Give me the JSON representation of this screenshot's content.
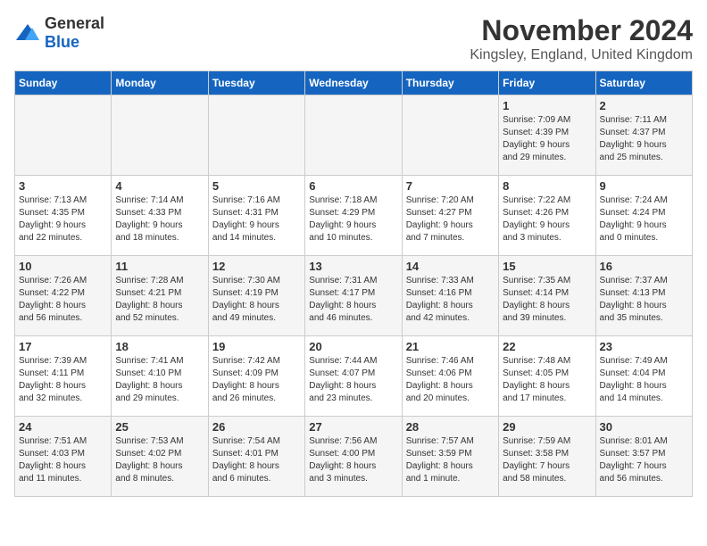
{
  "header": {
    "logo_general": "General",
    "logo_blue": "Blue",
    "month_title": "November 2024",
    "location": "Kingsley, England, United Kingdom"
  },
  "weekdays": [
    "Sunday",
    "Monday",
    "Tuesday",
    "Wednesday",
    "Thursday",
    "Friday",
    "Saturday"
  ],
  "weeks": [
    [
      {
        "day": "",
        "info": ""
      },
      {
        "day": "",
        "info": ""
      },
      {
        "day": "",
        "info": ""
      },
      {
        "day": "",
        "info": ""
      },
      {
        "day": "",
        "info": ""
      },
      {
        "day": "1",
        "info": "Sunrise: 7:09 AM\nSunset: 4:39 PM\nDaylight: 9 hours\nand 29 minutes."
      },
      {
        "day": "2",
        "info": "Sunrise: 7:11 AM\nSunset: 4:37 PM\nDaylight: 9 hours\nand 25 minutes."
      }
    ],
    [
      {
        "day": "3",
        "info": "Sunrise: 7:13 AM\nSunset: 4:35 PM\nDaylight: 9 hours\nand 22 minutes."
      },
      {
        "day": "4",
        "info": "Sunrise: 7:14 AM\nSunset: 4:33 PM\nDaylight: 9 hours\nand 18 minutes."
      },
      {
        "day": "5",
        "info": "Sunrise: 7:16 AM\nSunset: 4:31 PM\nDaylight: 9 hours\nand 14 minutes."
      },
      {
        "day": "6",
        "info": "Sunrise: 7:18 AM\nSunset: 4:29 PM\nDaylight: 9 hours\nand 10 minutes."
      },
      {
        "day": "7",
        "info": "Sunrise: 7:20 AM\nSunset: 4:27 PM\nDaylight: 9 hours\nand 7 minutes."
      },
      {
        "day": "8",
        "info": "Sunrise: 7:22 AM\nSunset: 4:26 PM\nDaylight: 9 hours\nand 3 minutes."
      },
      {
        "day": "9",
        "info": "Sunrise: 7:24 AM\nSunset: 4:24 PM\nDaylight: 9 hours\nand 0 minutes."
      }
    ],
    [
      {
        "day": "10",
        "info": "Sunrise: 7:26 AM\nSunset: 4:22 PM\nDaylight: 8 hours\nand 56 minutes."
      },
      {
        "day": "11",
        "info": "Sunrise: 7:28 AM\nSunset: 4:21 PM\nDaylight: 8 hours\nand 52 minutes."
      },
      {
        "day": "12",
        "info": "Sunrise: 7:30 AM\nSunset: 4:19 PM\nDaylight: 8 hours\nand 49 minutes."
      },
      {
        "day": "13",
        "info": "Sunrise: 7:31 AM\nSunset: 4:17 PM\nDaylight: 8 hours\nand 46 minutes."
      },
      {
        "day": "14",
        "info": "Sunrise: 7:33 AM\nSunset: 4:16 PM\nDaylight: 8 hours\nand 42 minutes."
      },
      {
        "day": "15",
        "info": "Sunrise: 7:35 AM\nSunset: 4:14 PM\nDaylight: 8 hours\nand 39 minutes."
      },
      {
        "day": "16",
        "info": "Sunrise: 7:37 AM\nSunset: 4:13 PM\nDaylight: 8 hours\nand 35 minutes."
      }
    ],
    [
      {
        "day": "17",
        "info": "Sunrise: 7:39 AM\nSunset: 4:11 PM\nDaylight: 8 hours\nand 32 minutes."
      },
      {
        "day": "18",
        "info": "Sunrise: 7:41 AM\nSunset: 4:10 PM\nDaylight: 8 hours\nand 29 minutes."
      },
      {
        "day": "19",
        "info": "Sunrise: 7:42 AM\nSunset: 4:09 PM\nDaylight: 8 hours\nand 26 minutes."
      },
      {
        "day": "20",
        "info": "Sunrise: 7:44 AM\nSunset: 4:07 PM\nDaylight: 8 hours\nand 23 minutes."
      },
      {
        "day": "21",
        "info": "Sunrise: 7:46 AM\nSunset: 4:06 PM\nDaylight: 8 hours\nand 20 minutes."
      },
      {
        "day": "22",
        "info": "Sunrise: 7:48 AM\nSunset: 4:05 PM\nDaylight: 8 hours\nand 17 minutes."
      },
      {
        "day": "23",
        "info": "Sunrise: 7:49 AM\nSunset: 4:04 PM\nDaylight: 8 hours\nand 14 minutes."
      }
    ],
    [
      {
        "day": "24",
        "info": "Sunrise: 7:51 AM\nSunset: 4:03 PM\nDaylight: 8 hours\nand 11 minutes."
      },
      {
        "day": "25",
        "info": "Sunrise: 7:53 AM\nSunset: 4:02 PM\nDaylight: 8 hours\nand 8 minutes."
      },
      {
        "day": "26",
        "info": "Sunrise: 7:54 AM\nSunset: 4:01 PM\nDaylight: 8 hours\nand 6 minutes."
      },
      {
        "day": "27",
        "info": "Sunrise: 7:56 AM\nSunset: 4:00 PM\nDaylight: 8 hours\nand 3 minutes."
      },
      {
        "day": "28",
        "info": "Sunrise: 7:57 AM\nSunset: 3:59 PM\nDaylight: 8 hours\nand 1 minute."
      },
      {
        "day": "29",
        "info": "Sunrise: 7:59 AM\nSunset: 3:58 PM\nDaylight: 7 hours\nand 58 minutes."
      },
      {
        "day": "30",
        "info": "Sunrise: 8:01 AM\nSunset: 3:57 PM\nDaylight: 7 hours\nand 56 minutes."
      }
    ]
  ]
}
